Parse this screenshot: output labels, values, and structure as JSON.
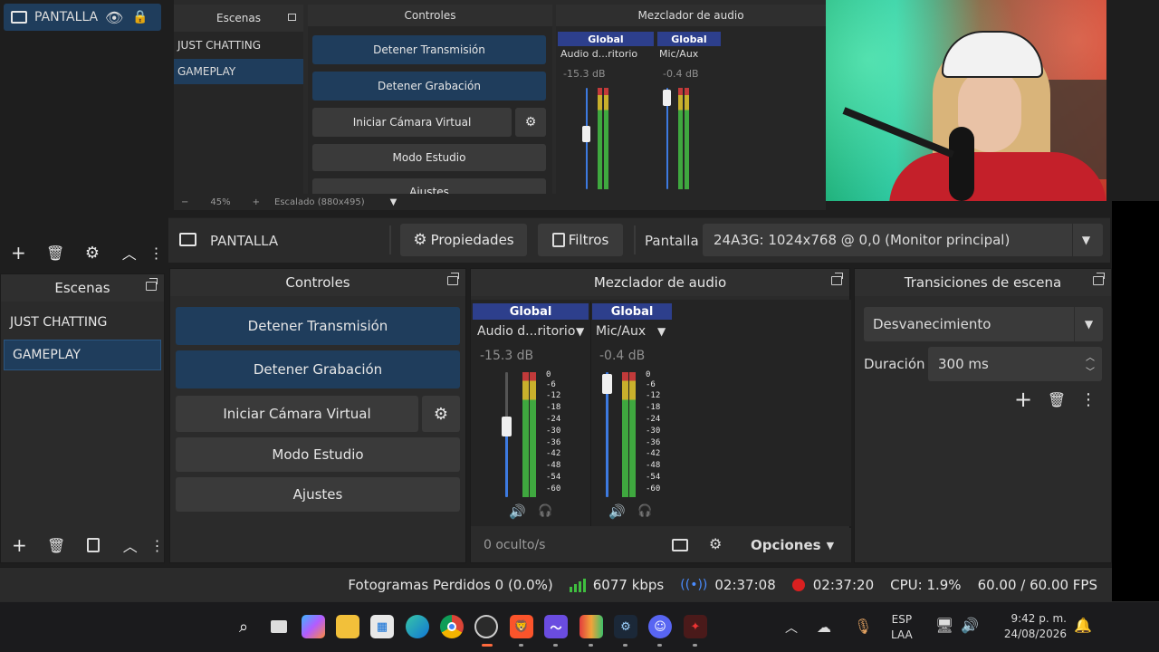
{
  "preview": {
    "scenes_title": "Escenas",
    "scenes": [
      "JUST CHATTING",
      "GAMEPLAY"
    ],
    "controls_title": "Controles",
    "controls": {
      "stop_stream": "Detener Transmisión",
      "stop_record": "Detener Grabación",
      "virtual_cam": "Iniciar Cámara Virtual",
      "studio_mode": "Modo Estudio",
      "settings": "Ajustes"
    },
    "mixer_title": "Mezclador de audio",
    "ch1": {
      "head": "Global",
      "name": "Audio d...ritorio",
      "db": "-15.3 dB"
    },
    "ch2": {
      "head": "Global",
      "name": "Mic/Aux",
      "db": "-0.4 dB"
    },
    "zoom": "45%",
    "scale": "Escalado (880x495)",
    "source_name": "PANTALLA"
  },
  "source_bar": {
    "source_label": "PANTALLA",
    "properties": "Propiedades",
    "filters": "Filtros",
    "display_label": "Pantalla",
    "display_value": "24A3G: 1024x768 @ 0,0 (Monitor principal)"
  },
  "scenes": {
    "title": "Escenas",
    "items": [
      "JUST CHATTING",
      "GAMEPLAY"
    ]
  },
  "controls": {
    "title": "Controles",
    "stop_stream": "Detener Transmisión",
    "stop_record": "Detener Grabación",
    "virtual_cam": "Iniciar Cámara Virtual",
    "studio_mode": "Modo Estudio",
    "settings": "Ajustes"
  },
  "mixer": {
    "title": "Mezclador de audio",
    "channels": [
      {
        "head": "Global",
        "name": "Audio d...ritorio",
        "db": "-15.3 dB",
        "level": 0.45
      },
      {
        "head": "Global",
        "name": "Mic/Aux",
        "db": "-0.4 dB",
        "level": 0.95
      }
    ],
    "ticks": [
      "0",
      "-6",
      "-12",
      "-18",
      "-24",
      "-30",
      "-36",
      "-42",
      "-48",
      "-54",
      "-60"
    ],
    "hidden": "0 oculto/s",
    "options": "Opciones"
  },
  "transitions": {
    "title": "Transiciones de escena",
    "type": "Desvanecimiento",
    "duration_label": "Duración",
    "duration_value": "300 ms"
  },
  "status": {
    "dropped": "Fotogramas Perdidos 0 (0.0%)",
    "bitrate": "6077 kbps",
    "stream_time": "02:37:08",
    "rec_time": "02:37:20",
    "cpu": "CPU: 1.9%",
    "fps": "60.00 / 60.00 FPS"
  },
  "taskbar": {
    "lang1": "ESP",
    "lang2": "LAA",
    "time": "9:42 p. m.",
    "date": "24/08/2026"
  },
  "colors": {
    "accent": "#1f3d5c",
    "channel_head": "#2d3f8c",
    "rec_red": "#d92020",
    "bitrate_green": "#3fbf3f"
  }
}
